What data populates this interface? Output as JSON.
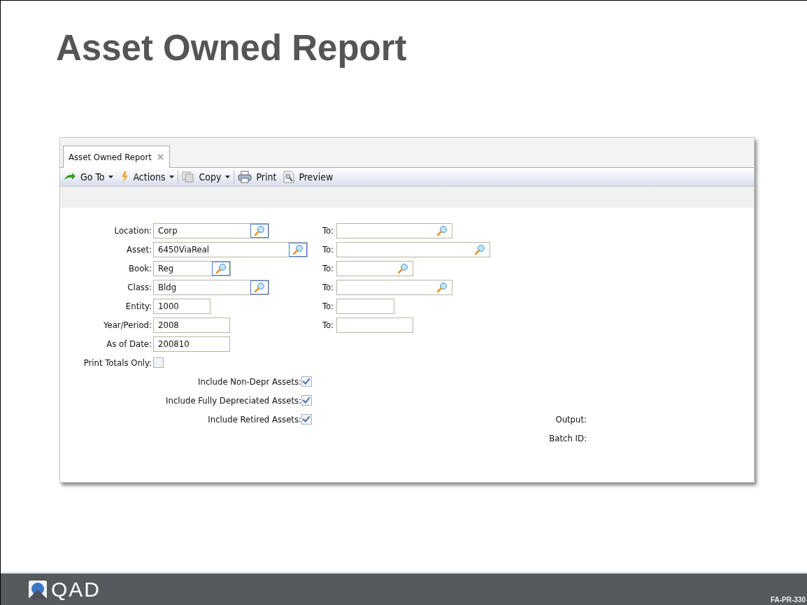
{
  "slide_title": "Asset Owned Report",
  "window": {
    "tab": {
      "label": "Asset Owned Report",
      "selected": true,
      "closable": true
    },
    "toolbar": [
      {
        "label": "Go To",
        "dropdown": true,
        "separator_after": false
      },
      {
        "label": "Actions",
        "dropdown": true,
        "separator_after": true
      },
      {
        "label": "Copy",
        "dropdown": true,
        "separator_after": true
      },
      {
        "label": "Print",
        "dropdown": false,
        "separator_after": false
      },
      {
        "label": "Preview",
        "dropdown": false,
        "separator_after": false
      }
    ],
    "fields": [
      {
        "kind": "range",
        "label": "Location:",
        "value": "Corp",
        "lookup": true,
        "to_label": "To:",
        "to_lookup": true
      },
      {
        "kind": "range",
        "label": "Asset:",
        "value": "6450ViaReal",
        "lookup": true,
        "to_label": "To:",
        "to_lookup": true
      },
      {
        "kind": "range",
        "label": "Book:",
        "value": "Reg",
        "lookup": true,
        "to_label": "To:",
        "to_lookup": true
      },
      {
        "kind": "range",
        "label": "Class:",
        "value": "Bldg",
        "lookup": true,
        "to_label": "To:",
        "to_lookup": true
      },
      {
        "kind": "range",
        "label": "Entity:",
        "value": "1000",
        "lookup": false,
        "to_label": "To:",
        "to_lookup": false
      },
      {
        "kind": "range",
        "label": "Year/Period:",
        "value": "2008",
        "lookup": false,
        "to_label": "To:",
        "to_lookup": false
      },
      {
        "kind": "single",
        "label": "As of Date:",
        "value": "200810",
        "lookup": false
      },
      {
        "kind": "checkbox",
        "label": "Print Totals Only:",
        "checked": false
      }
    ],
    "include_options": [
      {
        "label": "Include Non-Depr Assets:",
        "checked": true
      },
      {
        "label": "Include Fully Depreciated Assets:",
        "checked": true
      },
      {
        "label": "Include Retired Assets:",
        "checked": true
      }
    ],
    "output_labels": [
      "Output:",
      "Batch ID:"
    ]
  },
  "footer": {
    "logo": "QAD",
    "code": "FA-PR-330"
  }
}
